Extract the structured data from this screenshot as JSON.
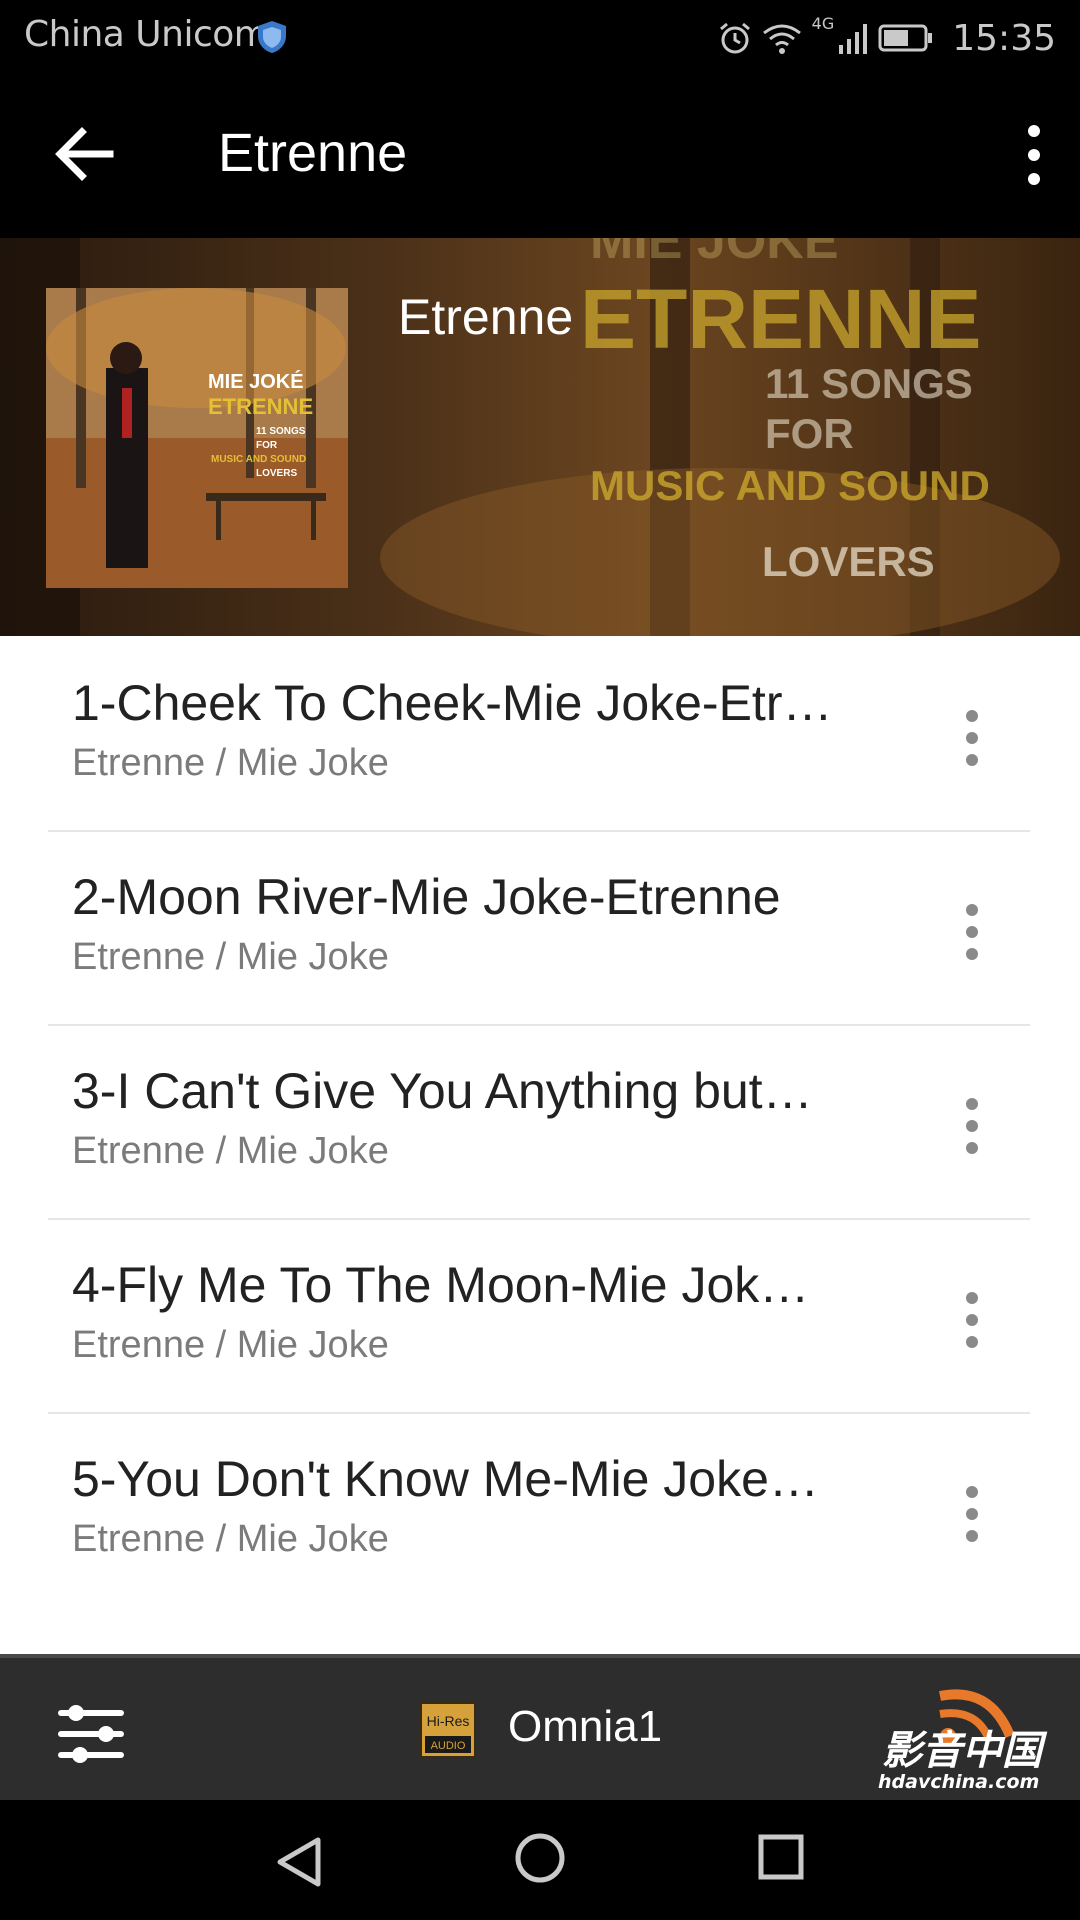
{
  "status_bar": {
    "carrier": "China Unicom",
    "network": "4G",
    "time": "15:35",
    "icons": [
      "shield-icon",
      "alarm-icon",
      "wifi-icon",
      "signal-icon",
      "battery-icon"
    ]
  },
  "app_bar": {
    "title": "Etrenne",
    "back_icon": "arrow-left-icon",
    "menu_icon": "more-vertical-icon"
  },
  "header": {
    "title": "Etrenne",
    "cover_text": {
      "artist": "MIE JOKÉ",
      "album": "ETRENNE",
      "line1": "11 SONGS",
      "line2": "FOR",
      "line3": "MUSIC AND SOUND",
      "line4": "LOVERS"
    },
    "background_text": {
      "top": "MIE JOKE",
      "album": "ETRENNE",
      "line1": "11 SONGS",
      "line2": "FOR",
      "line3": "MUSIC AND SOUND",
      "line4": "LOVERS"
    }
  },
  "tracks": [
    {
      "title": "1-Cheek To Cheek-Mie Joke-Etr…",
      "subtitle": "Etrenne / Mie Joke"
    },
    {
      "title": "2-Moon River-Mie Joke-Etrenne",
      "subtitle": "Etrenne / Mie Joke"
    },
    {
      "title": "3-I Can't Give You Anything but…",
      "subtitle": "Etrenne / Mie Joke"
    },
    {
      "title": "4-Fly Me To The Moon-Mie Jok…",
      "subtitle": "Etrenne / Mie Joke"
    },
    {
      "title": "5-You Don't Know Me-Mie Joke…",
      "subtitle": "Etrenne / Mie Joke"
    }
  ],
  "player_bar": {
    "device_name": "Omnia1",
    "badge_line1": "Hi-Res",
    "badge_line2": "AUDIO",
    "eq_icon": "equalizer-icon"
  },
  "watermark": {
    "cn": "影音中国",
    "url": "hdavchina.com"
  },
  "colors": {
    "bar_bg": "#000000",
    "list_bg": "#ffffff",
    "player_bg": "#2d2d2d",
    "title_text": "#222222",
    "subtitle_text": "#7b7b7b",
    "badge_gold": "#d6a13a"
  }
}
